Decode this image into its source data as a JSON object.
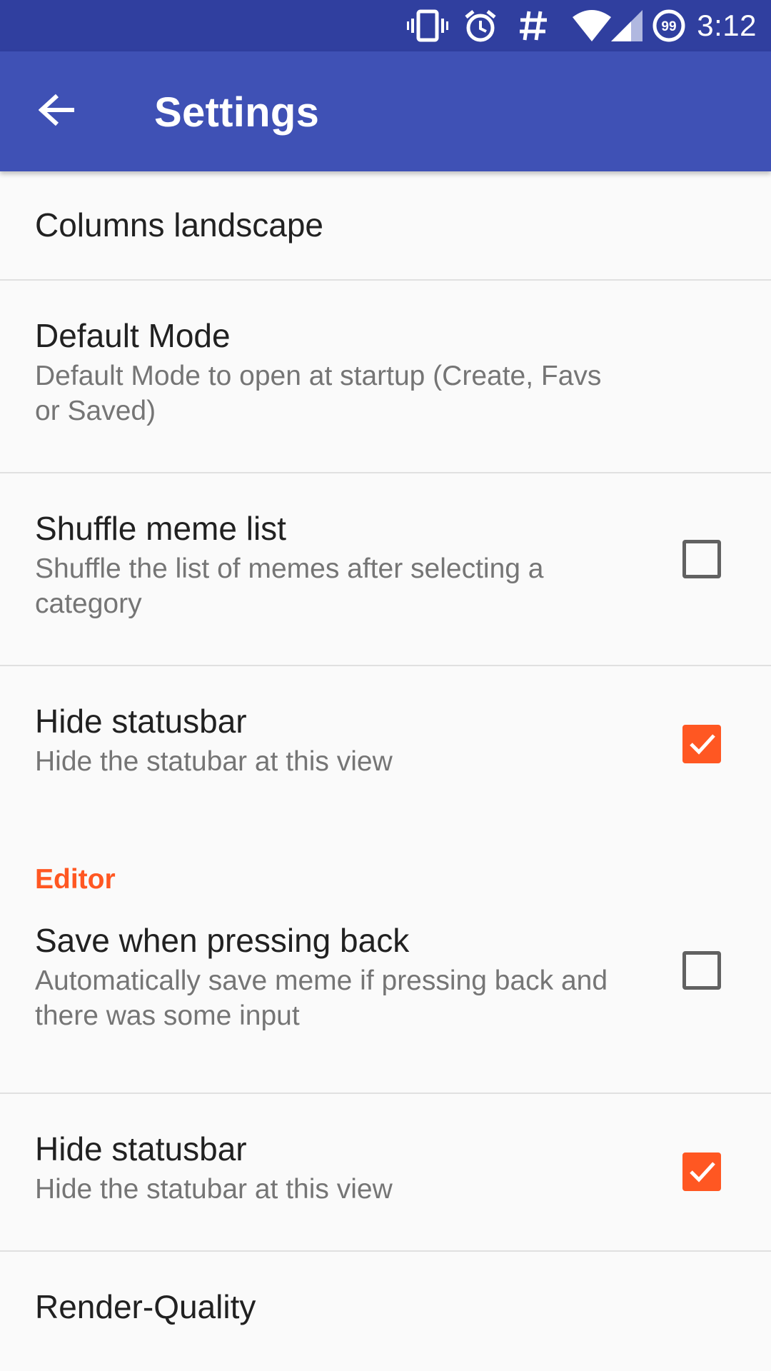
{
  "status_bar": {
    "time": "3:12",
    "icons": [
      "vibrate-icon",
      "alarm-icon",
      "hashtag-icon",
      "wifi-icon",
      "signal-icon",
      "battery-99-icon"
    ],
    "battery_level": "99"
  },
  "app_bar": {
    "title": "Settings",
    "back_icon": "arrow-back-icon"
  },
  "prefs": [
    {
      "title": "Columns landscape"
    },
    {
      "title": "Default Mode",
      "summary": "Default Mode to open at startup (Create, Favs or Saved)"
    },
    {
      "title": "Shuffle meme list",
      "summary": "Shuffle the list of memes after selecting a category",
      "checked": false
    },
    {
      "title": "Hide statusbar",
      "summary": "Hide the statubar at this view",
      "checked": true
    }
  ],
  "editor": {
    "category": "Editor",
    "prefs": [
      {
        "title": "Save when pressing back",
        "summary": "Automatically save meme if pressing back and there was some input",
        "checked": false
      },
      {
        "title": "Hide statusbar",
        "summary": "Hide the statubar at this view",
        "checked": true
      },
      {
        "title": "Render-Quality"
      }
    ]
  },
  "colors": {
    "status_bar": "#303f9f",
    "app_bar": "#3f51b5",
    "accent": "#ff5722",
    "background": "#fafafa"
  }
}
